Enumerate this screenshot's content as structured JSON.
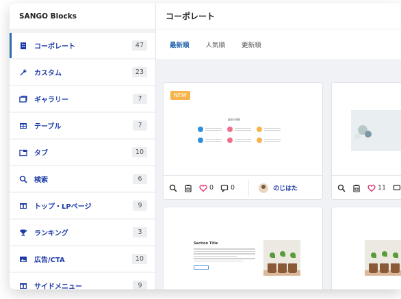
{
  "sidebar": {
    "brand": "SANGO Blocks",
    "items": [
      {
        "label": "コーポレート",
        "count": "47",
        "icon": "building-icon"
      },
      {
        "label": "カスタム",
        "count": "23",
        "icon": "wrench-icon"
      },
      {
        "label": "ギャラリー",
        "count": "7",
        "icon": "gallery-icon"
      },
      {
        "label": "テーブル",
        "count": "7",
        "icon": "table-icon"
      },
      {
        "label": "タブ",
        "count": "10",
        "icon": "tab-icon"
      },
      {
        "label": "検索",
        "count": "6",
        "icon": "search-icon"
      },
      {
        "label": "トップ・LPページ",
        "count": "9",
        "icon": "layout-icon"
      },
      {
        "label": "ランキング",
        "count": "3",
        "icon": "trophy-icon"
      },
      {
        "label": "広告/CTA",
        "count": "10",
        "icon": "image-icon"
      },
      {
        "label": "サイドメニュー",
        "count": "9",
        "icon": "layout-icon"
      }
    ]
  },
  "main": {
    "title": "コーポレート",
    "sort_tabs": [
      "最新順",
      "人気順",
      "更新順"
    ],
    "cards": [
      {
        "badge": "NEW",
        "likes": "0",
        "comments": "0",
        "author": "のじはた",
        "preview_title": "製品の特徴"
      },
      {
        "likes": "11"
      },
      {
        "preview_title": "Section Title"
      },
      {}
    ]
  },
  "colors": {
    "accent": "#2b6cb0",
    "link": "#1c3ba8",
    "badge": "#f8b34c",
    "heart": "#e0245e"
  }
}
